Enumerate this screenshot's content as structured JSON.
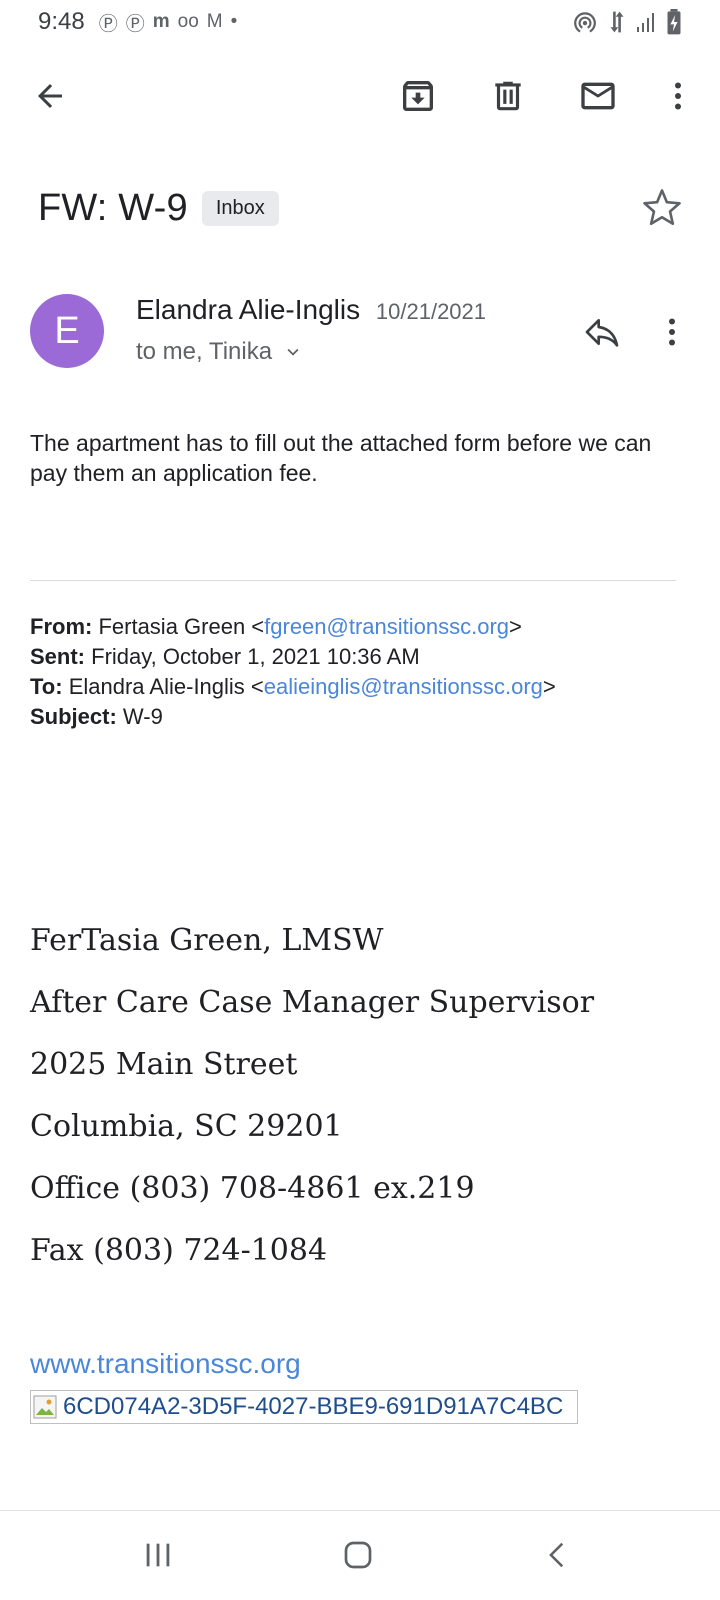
{
  "status_bar": {
    "time": "9:48",
    "left_icons": [
      "pinterest-icon",
      "pinterest-icon",
      "app-icon",
      "voicemail-icon",
      "gmail-icon",
      "dot-icon"
    ],
    "right_icons": [
      "hotspot-icon",
      "data-icon",
      "signal-icon",
      "battery-icon"
    ]
  },
  "toolbar": {
    "icons": [
      "back-arrow-icon",
      "archive-icon",
      "delete-icon",
      "mark-unread-icon",
      "more-vert-icon"
    ]
  },
  "email": {
    "subject": "FW: W-9",
    "label": "Inbox",
    "sender": {
      "initial": "E",
      "avatar_color": "#9c6ad6",
      "name": "Elandra Alie-Inglis",
      "date": "10/21/2021",
      "recipients": "to me, Tinika"
    },
    "body": "The apartment has to fill out the attached form before we can pay them an application fee.",
    "forwarded": {
      "from_label": "From:",
      "from_name": "Fertasia Green <",
      "from_email": "fgreen@transitionssc.org",
      "from_close": ">",
      "sent_label": "Sent:",
      "sent_value": "Friday, October 1, 2021 10:36 AM",
      "to_label": "To:",
      "to_name": "Elandra Alie-Inglis <",
      "to_email": "ealieinglis@transitionssc.org",
      "to_close": ">",
      "subject_label": "Subject:",
      "subject_value": "W-9"
    },
    "signature": [
      "FerTasia Green, LMSW",
      "After Care Case Manager Supervisor",
      "2025 Main Street",
      "Columbia, SC 29201",
      "Office (803) 708-4861 ex.219",
      "Fax (803) 724-1084"
    ],
    "website": "www.transitionssc.org",
    "image_alt": "6CD074A2-3D5F-4027-BBE9-691D91A7C4BC"
  },
  "nav_bar": {
    "icons": [
      "recent-apps-icon",
      "home-icon",
      "back-icon"
    ]
  },
  "colors": {
    "accent_link": "#4a86d9",
    "avatar": "#9c6ad6",
    "chip_bg": "#e8eaed"
  }
}
